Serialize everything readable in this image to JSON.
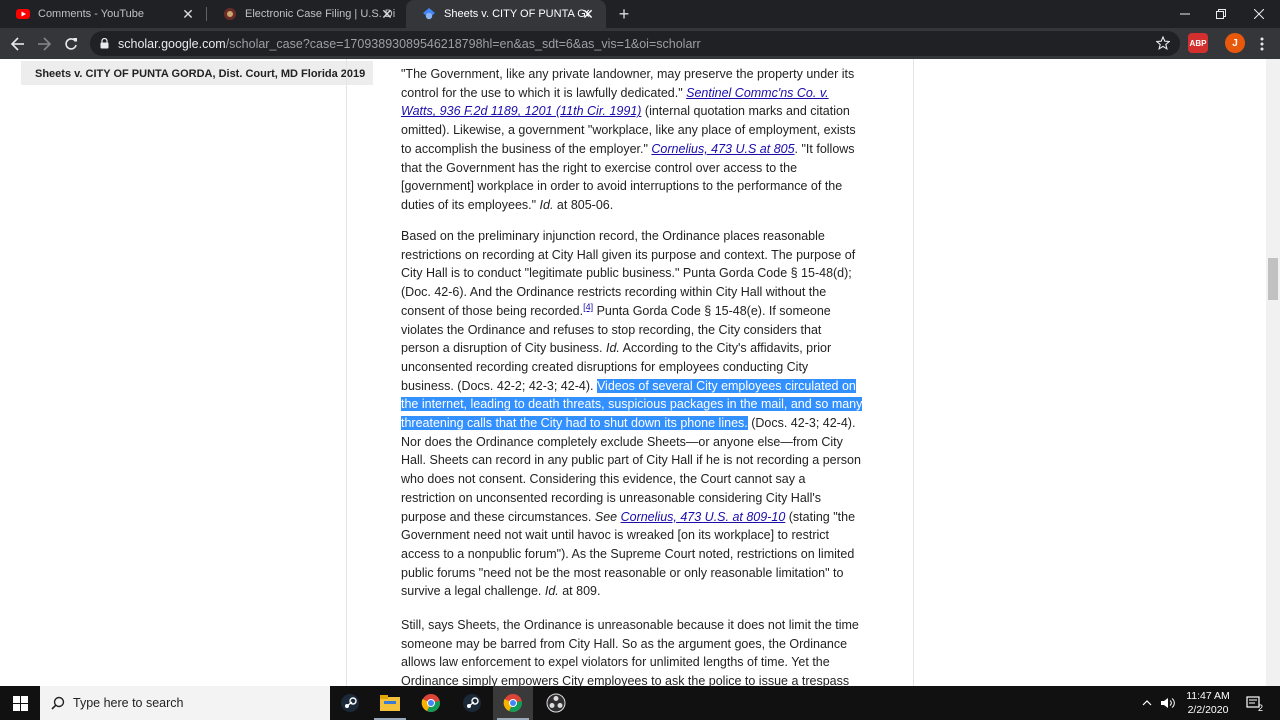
{
  "browser": {
    "tabs": [
      {
        "title": "Comments - YouTube",
        "close": "✕"
      },
      {
        "title": "Electronic Case Filing | U.S. District",
        "close": "✕"
      },
      {
        "title": "Sheets v. CITY OF PUNTA GORDA",
        "close": "✕"
      }
    ],
    "new_tab": "+",
    "url_host": "scholar.google.com",
    "url_path": "/scholar_case?case=17093893089546218798hl=en&as_sdt=6&as_vis=1&oi=scholarr",
    "ext_abp": "ABP",
    "profile_initial": "J"
  },
  "page": {
    "case_header": "Sheets v. CITY OF PUNTA GORDA, Dist. Court, MD Florida 2019",
    "p1": {
      "t1": "\"The Government, like any private landowner, may preserve the property under its control for the use to which it is lawfully dedicated.\" ",
      "l1": "Sentinel Commc'ns Co. v. Watts, 936 F.2d 1189, 1201 (11th Cir. 1991)",
      "t2": " (internal quotation marks and citation omitted). Likewise, a government \"workplace, like any place of employment, exists to accomplish the business of the employer.\" ",
      "l2": "Cornelius, 473 U.S at 805",
      "t3": ". \"It follows that the Government has the right to exercise control over access to the [government] workplace in order to avoid interruptions to the performance of the duties of its employees.\" ",
      "i1": "Id.",
      "t4": " at 805-06."
    },
    "p2": {
      "t1": "Based on the preliminary injunction record, the Ordinance places reasonable restrictions on recording at City Hall given its purpose and context. The purpose of City Hall is to conduct \"legitimate public business.\" Punta Gorda Code § 15-48(d); (Doc. 42-6). And the Ordinance restricts recording within City Hall without the consent of those being recorded.",
      "fn": "[4]",
      "t2": " Punta Gorda Code § 15-48(e). If someone violates the Ordinance and refuses to stop recording, the City considers that person a disruption of City business. ",
      "i1": "Id.",
      "t3": " According to the City's affidavits, prior unconsented recording created disruptions for employees conducting City business. (Docs. 42-2; 42-3; 42-4). ",
      "hl": "Videos of several City employees circulated on the internet, leading to death threats, suspicious packages in the mail, and so many threatening calls that the City had to shut down its phone lines.",
      "t4": " (Docs. 42-3; 42-4). Nor does the Ordinance completely exclude Sheets—or anyone else—from City Hall. Sheets can record in any public part of City Hall if he is not recording a person who does not consent. Considering this evidence, the Court cannot say a restriction on unconsented recording is unreasonable considering City Hall's purpose and these circumstances. ",
      "i2": "See",
      "l1": "Cornelius, 473 U.S. at 809-10",
      "t5": " (stating \"the Government need not wait until havoc is wreaked [on its workplace] to restrict access to a nonpublic forum\"). As the Supreme Court noted, restrictions on limited public forums \"need not be the most reasonable or only reasonable limitation\" to survive a legal challenge. ",
      "i3": "Id.",
      "t6": " at 809."
    },
    "p3": {
      "t1": "Still, says Sheets, the Ordinance is unreasonable because it does not limit the time someone may be barred from City Hall. So as the argument goes, the Ordinance allows law enforcement to expel violators for unlimited lengths of time. Yet the Ordinance simply empowers City employees to ask the police to issue a trespass"
    }
  },
  "taskbar": {
    "search_placeholder": "Type here to search",
    "time": "11:47 AM",
    "date": "2/2/2020",
    "notif_count": "2"
  },
  "colors": {
    "highlight": "#3390ff",
    "link": "#1a0dab",
    "chrome_dark": "#202124",
    "chrome_mid": "#35363a"
  }
}
